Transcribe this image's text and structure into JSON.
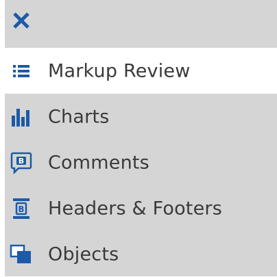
{
  "panel": {
    "close_icon": "close-icon",
    "accent_color": "#1d5aa8"
  },
  "menu": {
    "items": [
      {
        "label": "Markup Review",
        "icon": "list-icon",
        "active": true
      },
      {
        "label": "Charts",
        "icon": "bar-chart-icon",
        "active": false
      },
      {
        "label": "Comments",
        "icon": "comment-icon",
        "active": false
      },
      {
        "label": "Headers & Footers",
        "icon": "header-footer-icon",
        "active": false
      },
      {
        "label": "Objects",
        "icon": "objects-icon",
        "active": false
      }
    ]
  }
}
